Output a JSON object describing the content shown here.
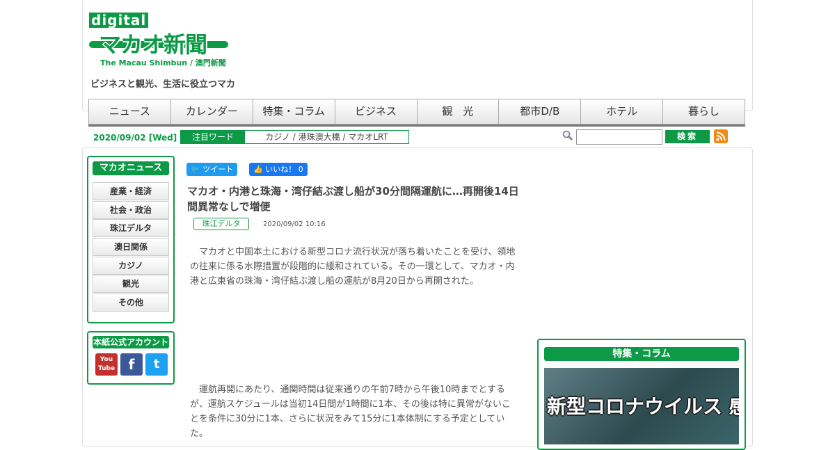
{
  "header": {
    "logo_digital": "digital",
    "logo_name": "マカオ新聞",
    "logo_sub": "The Macau Shimbun / 澳門新聞",
    "tagline": "ビジネスと観光、生活に役立つマカ"
  },
  "nav": {
    "items": [
      {
        "label": "ニュース"
      },
      {
        "label": "カレンダー"
      },
      {
        "label": "特集・コラム"
      },
      {
        "label": "ビジネス"
      },
      {
        "label": "観　光"
      },
      {
        "label": "都市D/B"
      },
      {
        "label": "ホテル"
      },
      {
        "label": "暮らし"
      }
    ]
  },
  "infobar": {
    "date": "2020/09/02 [Wed]",
    "watch_label": "注目ワード",
    "watch_words": "カジノ / 港珠澳大橋 / マカオLRT",
    "search_placeholder": "",
    "search_button": "検索"
  },
  "sidebar": {
    "news_title": "マカオニュース",
    "categories": [
      {
        "label": "産業・経済"
      },
      {
        "label": "社会・政治"
      },
      {
        "label": "珠江デルタ"
      },
      {
        "label": "澳日関係"
      },
      {
        "label": "カジノ"
      },
      {
        "label": "観光"
      },
      {
        "label": "その他"
      }
    ],
    "social_title": "本紙公式アカウント",
    "social": {
      "youtube": "You Tube",
      "facebook": "f",
      "twitter": "t"
    }
  },
  "article": {
    "tweet_label": "ツイート",
    "like_label": "いいね！ 0",
    "title": "マカオ・内港と珠海・湾仔結ぶ渡し船が30分間隔運航に…再開後14日間異常なしで増便",
    "tag": "珠江デルタ",
    "date": "2020/09/02 10:16",
    "paragraphs": [
      "マカオと中国本土における新型コロナ流行状況が落ち着いたことを受け、領地の往来に係る水際措置が段階的に緩和されている。その一環として、マカオ・内港と広東省の珠海・湾仔結ぶ渡し船の運航が8月20日から再開された。",
      "運航再開にあたり、通関時間は従来通りの午前7時から午後10時までとするが、運航スケジュールは当初14日間が1時間に1本、その後は特に異常がないことを条件に30分に1本、さらに状況をみて15分に1本体制にする予定としていた。"
    ]
  },
  "feature": {
    "title": "特集・コラム",
    "image_text": "新型コロナウイルス 感染症"
  },
  "colors": {
    "brand": "#0c9a46",
    "rss": "#f28a1a",
    "twitter": "#1d9bf0",
    "facebook": "#1877f2"
  }
}
